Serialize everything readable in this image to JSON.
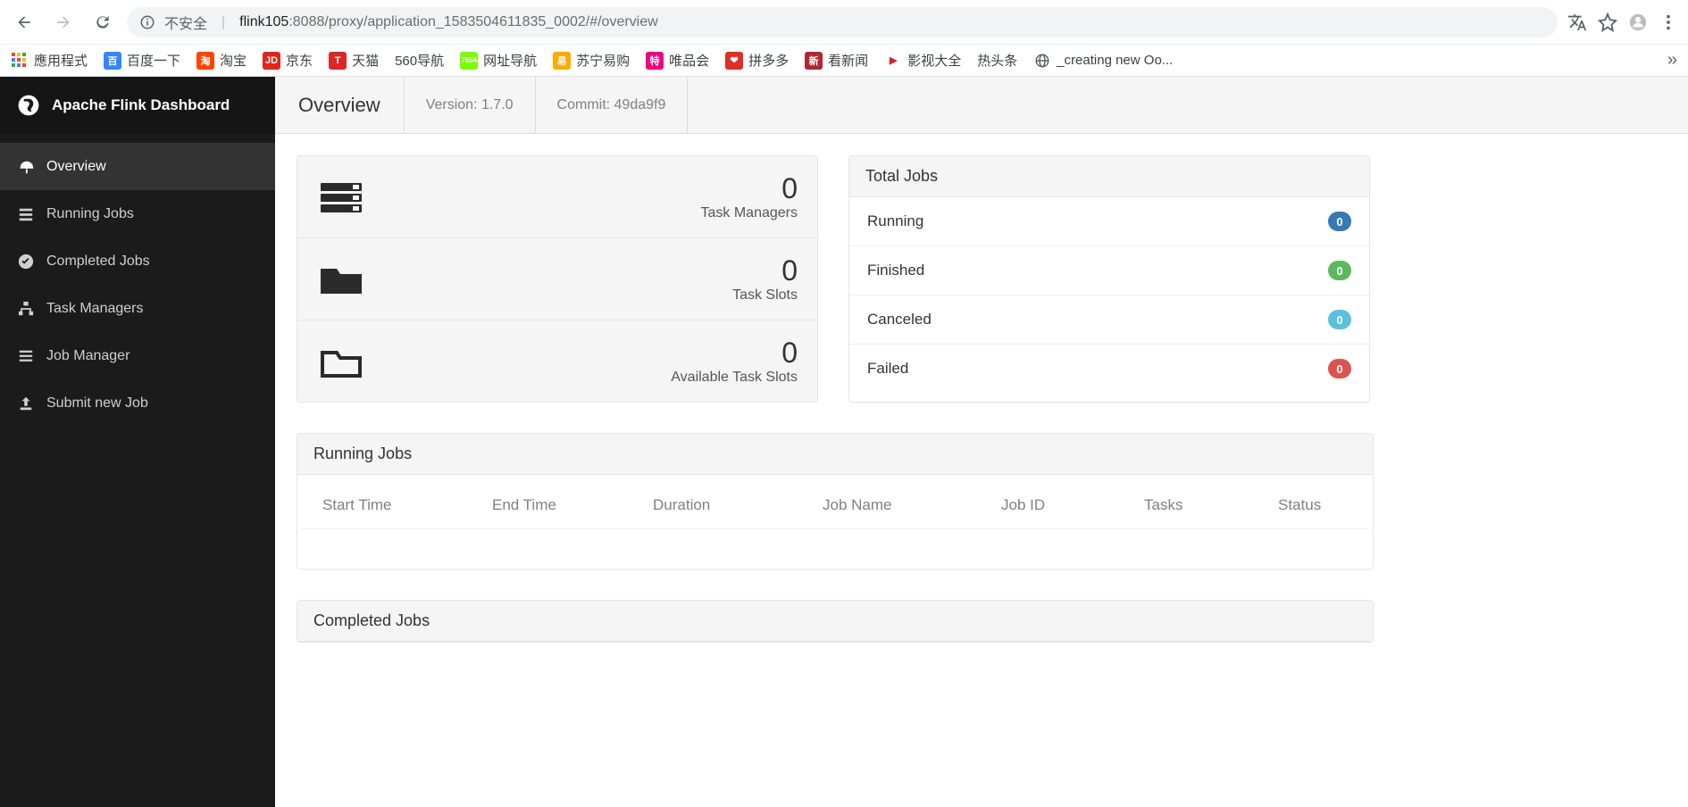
{
  "browser": {
    "url_security": "不安全",
    "url_host": "flink105",
    "url_path": ":8088/proxy/application_1583504611835_0002/#/overview",
    "bookmarks": [
      {
        "label": "應用程式",
        "bg": "grid"
      },
      {
        "label": "百度一下",
        "bg": "#3385ff",
        "txt": "百"
      },
      {
        "label": "淘宝",
        "bg": "#ff4400",
        "txt": "淘"
      },
      {
        "label": "京东",
        "bg": "#e1251b",
        "txt": "JD"
      },
      {
        "label": "天猫",
        "bg": "#dd2727",
        "txt": "T"
      },
      {
        "label": "560导航",
        "bg": "",
        "txt": ""
      },
      {
        "label": "网址导航",
        "bg": "#7CFC00",
        "txt": "7654",
        "small": true
      },
      {
        "label": "苏宁易购",
        "bg": "#ffaa00",
        "txt": "易"
      },
      {
        "label": "唯品会",
        "bg": "#f10180",
        "txt": "特"
      },
      {
        "label": "拼多多",
        "bg": "#e02e24",
        "txt": "❤"
      },
      {
        "label": "看新闻",
        "bg": "#b0272f",
        "txt": "新"
      },
      {
        "label": "影视大全",
        "bg": "#fff",
        "txt": "▶",
        "fg": "#e02020"
      },
      {
        "label": "热头条",
        "bg": "",
        "txt": ""
      },
      {
        "label": "_creating new Oo...",
        "bg": "#808080",
        "txt": "◉",
        "globe": true
      }
    ]
  },
  "sidebar": {
    "title": "Apache Flink Dashboard",
    "items": [
      {
        "label": "Overview",
        "icon": "dashboard",
        "active": true
      },
      {
        "label": "Running Jobs",
        "icon": "list"
      },
      {
        "label": "Completed Jobs",
        "icon": "check"
      },
      {
        "label": "Task Managers",
        "icon": "sitemap"
      },
      {
        "label": "Job Manager",
        "icon": "bars"
      },
      {
        "label": "Submit new Job",
        "icon": "upload"
      }
    ]
  },
  "header": {
    "title": "Overview",
    "version_label": "Version: 1.7.0",
    "commit_label": "Commit: 49da9f9"
  },
  "stats": [
    {
      "value": "0",
      "label": "Task Managers",
      "icon": "servers"
    },
    {
      "value": "0",
      "label": "Task Slots",
      "icon": "folder"
    },
    {
      "value": "0",
      "label": "Available Task Slots",
      "icon": "folder-open"
    }
  ],
  "totals": {
    "title": "Total Jobs",
    "rows": [
      {
        "label": "Running",
        "count": "0",
        "cls": "b-blue"
      },
      {
        "label": "Finished",
        "count": "0",
        "cls": "b-green"
      },
      {
        "label": "Canceled",
        "count": "0",
        "cls": "b-cyan"
      },
      {
        "label": "Failed",
        "count": "0",
        "cls": "b-red"
      }
    ]
  },
  "running_jobs": {
    "title": "Running Jobs",
    "columns": [
      "Start Time",
      "End Time",
      "Duration",
      "Job Name",
      "Job ID",
      "Tasks",
      "Status"
    ]
  },
  "completed_jobs": {
    "title": "Completed Jobs"
  }
}
